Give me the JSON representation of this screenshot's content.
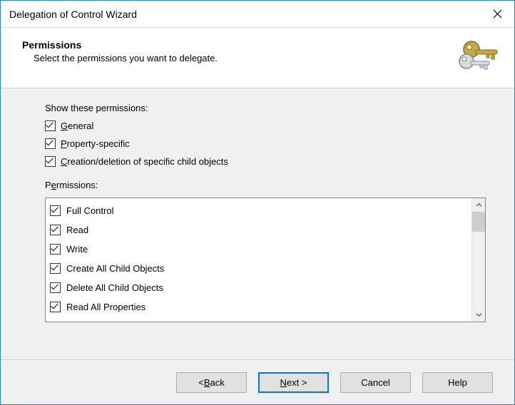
{
  "window": {
    "title": "Delegation of Control Wizard"
  },
  "header": {
    "title": "Permissions",
    "subtitle": "Select the permissions you want to delegate."
  },
  "showPermissions": {
    "label": "Show these permissions:",
    "items": [
      {
        "prefix": "",
        "hotkey": "G",
        "suffix": "eneral",
        "checked": true
      },
      {
        "prefix": "",
        "hotkey": "P",
        "suffix": "roperty-specific",
        "checked": true
      },
      {
        "prefix": "",
        "hotkey": "C",
        "suffix": "reation/deletion of specific child objects",
        "checked": true
      }
    ]
  },
  "permissionsList": {
    "labelPrefix": "P",
    "labelHotkey": "e",
    "labelSuffix": "rmissions:",
    "items": [
      {
        "label": "Full Control",
        "checked": true
      },
      {
        "label": "Read",
        "checked": true
      },
      {
        "label": "Write",
        "checked": true
      },
      {
        "label": "Create All Child Objects",
        "checked": true
      },
      {
        "label": "Delete All Child Objects",
        "checked": true
      },
      {
        "label": "Read All Properties",
        "checked": true
      }
    ]
  },
  "buttons": {
    "back": {
      "prefix": "< ",
      "hotkey": "B",
      "suffix": "ack"
    },
    "next": {
      "prefix": "",
      "hotkey": "N",
      "suffix": "ext >"
    },
    "cancel": "Cancel",
    "help": "Help"
  }
}
